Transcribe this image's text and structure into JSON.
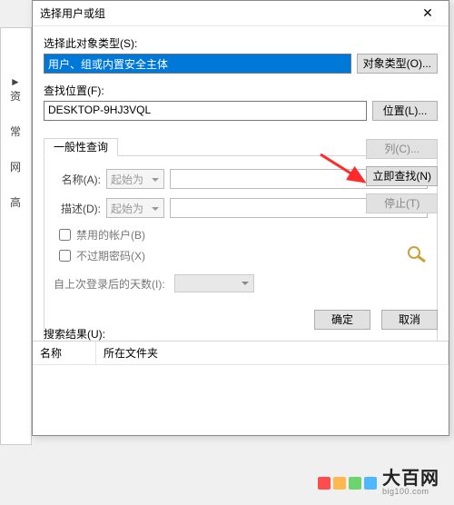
{
  "dialog": {
    "title": "选择用户或组",
    "object_type_label": "选择此对象类型(S):",
    "object_type_value": "用户、组或内置安全主体",
    "object_types_btn": "对象类型(O)...",
    "location_label": "查找位置(F):",
    "location_value": "DESKTOP-9HJ3VQL",
    "location_btn": "位置(L)...",
    "tab_general": "一般性查询",
    "name_label": "名称(A):",
    "name_op": "起始为",
    "desc_label": "描述(D):",
    "desc_op": "起始为",
    "chk_disabled": "禁用的帐户(B)",
    "chk_noexpire": "不过期密码(X)",
    "days_label": "自上次登录后的天数(I):",
    "columns_btn": "列(C)...",
    "find_now_btn": "立即查找(N)",
    "stop_btn": "停止(T)",
    "ok_btn": "确定",
    "cancel_btn": "取消",
    "results_label": "搜索结果(U):",
    "col_name": "名称",
    "col_folder": "所在文件夹"
  },
  "bg": {
    "explorer": "资",
    "items": [
      "常",
      "网",
      "",
      "",
      "高"
    ]
  },
  "watermark": {
    "zh": "大百网",
    "en": "big100.com",
    "colors": [
      "#ff4d4d",
      "#ffb84d",
      "#6dd36d",
      "#4db8ff"
    ]
  }
}
